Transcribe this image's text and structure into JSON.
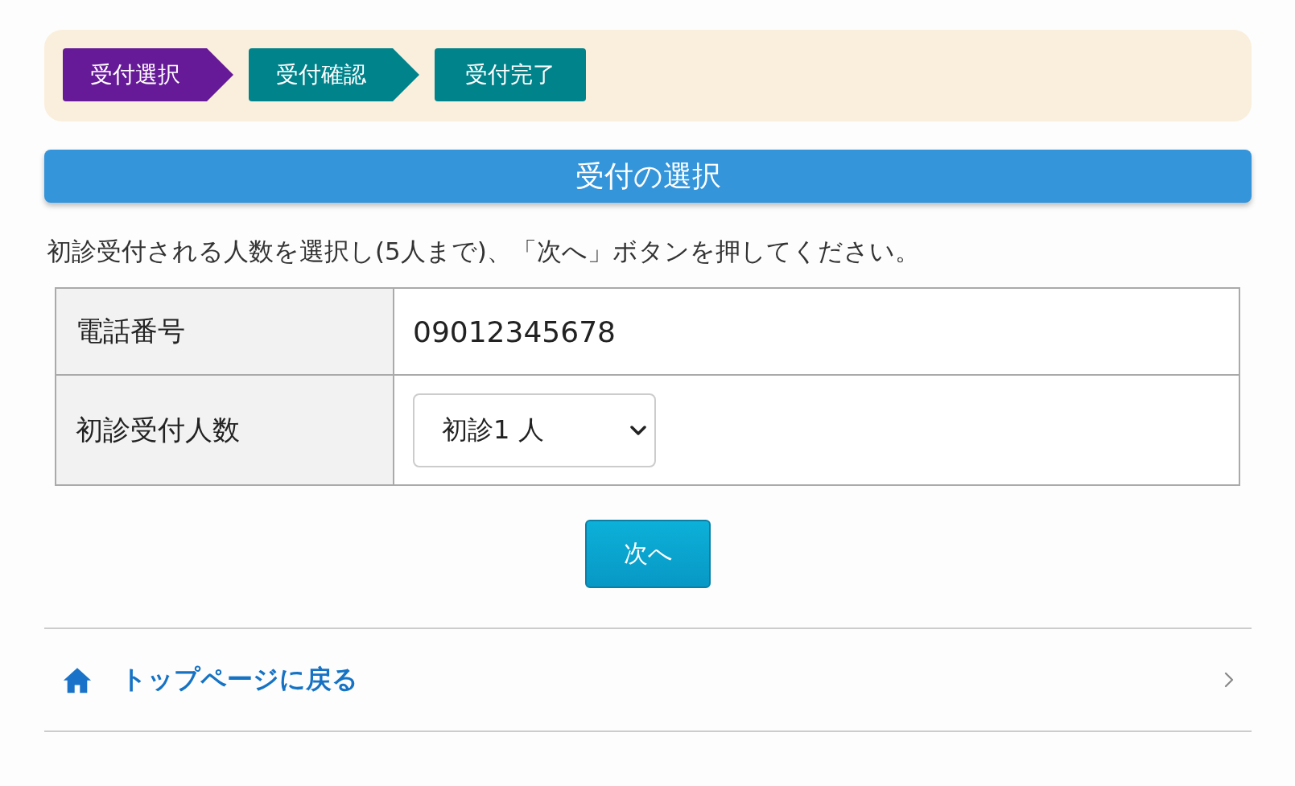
{
  "progress_steps": [
    {
      "label": "受付選択",
      "selected": true
    },
    {
      "label": "受付確認",
      "selected": false
    },
    {
      "label": "受付完了",
      "selected": false
    }
  ],
  "section_title": "受付の選択",
  "instruction": "初診受付される人数を選択し(5人まで)、「次へ」ボタンを押してください。",
  "form_rows": [
    {
      "kind": "text",
      "label": "電話番号",
      "value": "09012345678"
    },
    {
      "kind": "select",
      "label": "初診受付人数",
      "value": "初診1 人"
    }
  ],
  "next_button": {
    "label": "次へ"
  },
  "back_link": {
    "label": "トップページに戻る"
  }
}
